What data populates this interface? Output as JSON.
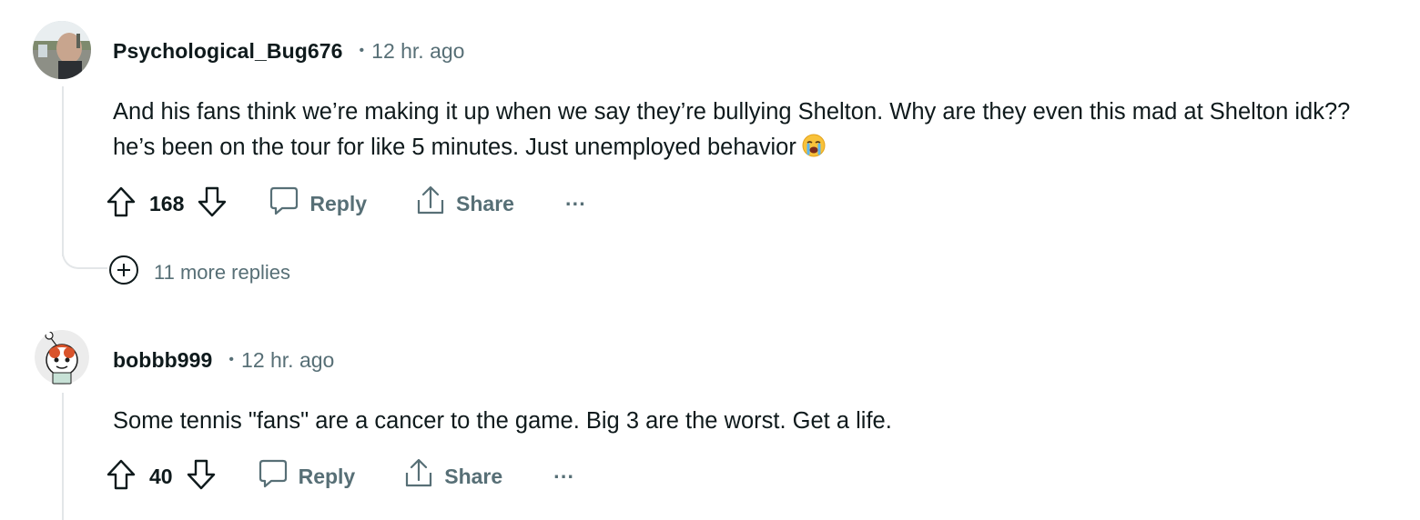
{
  "comments": [
    {
      "username": "Psychological_Bug676",
      "separator": "•",
      "time": "12 hr. ago",
      "body": "And his fans think we’re making it up when we say they’re bullying Shelton. Why are they even this mad at Shelton idk?? he’s been on the tour for like 5 minutes. Just unemployed behavior",
      "emoji": "loudly-crying-face",
      "score": "168",
      "reply_label": "Reply",
      "share_label": "Share",
      "more_label": "···",
      "more_replies": "11 more replies"
    },
    {
      "username": "bobbb999",
      "separator": "•",
      "time": "12 hr. ago",
      "body": "Some tennis \"fans\" are a cancer to the game. Big 3 are the worst. Get a life.",
      "score": "40",
      "reply_label": "Reply",
      "share_label": "Share",
      "more_label": "···"
    }
  ],
  "colors": {
    "text": "#0f1a1c",
    "muted": "#576f76",
    "thread_line": "#e3e6e8"
  }
}
